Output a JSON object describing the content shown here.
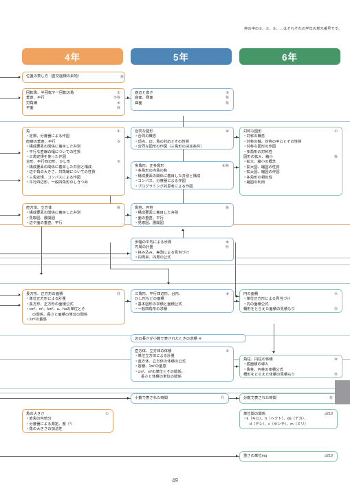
{
  "page": {
    "note": "枠の中の①、②、③、…はそれぞれの学年の単元番号です。",
    "page_number": "49",
    "colors": {
      "grade4": "#f0a35e",
      "grade5": "#4e86b8",
      "grade6": "#479668",
      "grade4_border": "#e2a765",
      "grade5_border": "#8fb4d4",
      "grade6_border": "#8dc1a5"
    }
  },
  "headers": {
    "grade4": "4年",
    "grade5": "5年",
    "grade6": "6年"
  },
  "boxes": {
    "g4_position": {
      "lines": [
        {
          "text": "位置の表し方（直交座標の素地）",
          "num": "⑲"
        }
      ]
    },
    "g4_rotation": {
      "lines": [
        {
          "text": "回転角、半回転や一回転の角",
          "num": "①"
        },
        {
          "text": "垂直、平行",
          "num": "⑤⑱"
        },
        {
          "text": "対角線",
          "num": "⑤"
        },
        {
          "text": "平面",
          "num": "⑱"
        }
      ]
    },
    "g5_base": {
      "lines": [
        {
          "text": "底辺と高さ",
          "num": "⑨"
        },
        {
          "text": "底面、側面",
          "num": "⑯"
        },
        {
          "text": "曲面",
          "num": "⑯"
        }
      ]
    },
    "g4_angle_shapes": {
      "lines": [
        {
          "text": "角",
          "num": "①",
          "kind": "head"
        },
        {
          "text": "定規、分度器による作図",
          "kind": "sub"
        },
        {
          "text": "直線の垂直、平行",
          "num": "⑤",
          "kind": "head"
        },
        {
          "text": "構成要素の関係に着目した弁別",
          "kind": "sub"
        },
        {
          "text": "平行な直線の幅についての性質",
          "kind": "sub"
        },
        {
          "text": "三角定規を使った作図",
          "kind": "sub"
        },
        {
          "text": "台形、平行四辺形、ひし形",
          "num": "⑤",
          "kind": "head"
        },
        {
          "text": "構成要素の関係に着目した弁別と構成",
          "kind": "sub"
        },
        {
          "text": "辺や角の大きさ、対角線についての性質",
          "kind": "sub"
        },
        {
          "text": "三角定規、コンパスによる作図",
          "kind": "sub"
        },
        {
          "text": "平行四辺形、一般四角形のしきつめ",
          "kind": "sub"
        }
      ]
    },
    "g5_congruent": {
      "lines": [
        {
          "text": "合同な図形",
          "num": "⑥",
          "kind": "head"
        },
        {
          "text": "合同の概念",
          "kind": "sub"
        },
        {
          "text": "頂点、辺、角の対応とその性質",
          "kind": "sub"
        },
        {
          "text": "合同な図形の作図（三角形の決定条件）",
          "kind": "sub"
        }
      ]
    },
    "g5_polygon": {
      "lines": [
        {
          "text": "多角形、正多角形",
          "num": "⑥⑱",
          "kind": "head"
        },
        {
          "text": "多角形の内角の和",
          "kind": "sub"
        },
        {
          "text": "構成要素の関係に着目した弁別と構成",
          "kind": "sub"
        },
        {
          "text": "コンパス、分度器による作図",
          "kind": "sub"
        },
        {
          "text": "プログラミング的思考による作図",
          "kind": "sub"
        }
      ]
    },
    "g6_symmetry": {
      "lines": [
        {
          "text": "対称な図形",
          "num": "①",
          "kind": "head"
        },
        {
          "text": "対称の概念",
          "kind": "sub"
        },
        {
          "text": "対称の軸、対称の中心とその性質",
          "kind": "sub"
        },
        {
          "text": "対称な図形の作図",
          "kind": "sub"
        },
        {
          "text": "多角形の対称性",
          "kind": "sub"
        },
        {
          "text": "図形の拡大、縮小",
          "num": "⑱",
          "kind": "head"
        },
        {
          "text": "拡大、縮小の概念",
          "kind": "sub"
        },
        {
          "text": "拡大図、縮図の性質",
          "kind": "sub"
        },
        {
          "text": "拡大図、縮図の作図",
          "kind": "sub"
        },
        {
          "text": "多角形の相似性",
          "kind": "sub"
        },
        {
          "text": "縮図の利用",
          "kind": "sub"
        }
      ]
    },
    "g4_solid": {
      "lines": [
        {
          "text": "直方体、立方体",
          "num": "⑱",
          "kind": "head"
        },
        {
          "text": "構成要素の関係に着目した弁別",
          "kind": "sub"
        },
        {
          "text": "見取図、展開図",
          "kind": "sub"
        },
        {
          "text": "辺や面の垂直、平行",
          "kind": "sub"
        }
      ]
    },
    "g5_prism": {
      "lines": [
        {
          "text": "角柱、円柱",
          "num": "⑯",
          "kind": "head"
        },
        {
          "text": "構成要素に着目した弁別",
          "kind": "sub"
        },
        {
          "text": "面の垂直、平行",
          "kind": "sub"
        },
        {
          "text": "見取図、展開図",
          "kind": "sub"
        }
      ]
    },
    "g5_circumference": {
      "lines": [
        {
          "text": "歩幅の平均による歩測",
          "num": "⑩",
          "kind": "head"
        },
        {
          "text": "円周の計量",
          "num": "⑭",
          "kind": "head"
        },
        {
          "text": "挟み込み、実測による見当づけ",
          "kind": "sub"
        },
        {
          "text": "円周率、円周の公式",
          "kind": "sub"
        }
      ]
    },
    "g4_area": {
      "lines": [
        {
          "text": "長方形、正方形の面積",
          "num": "⑬",
          "kind": "head"
        },
        {
          "text": "単位正方形による計量",
          "kind": "sub"
        },
        {
          "text": "長方形、正方形の面積公式",
          "kind": "sub"
        },
        {
          "text": "cm²、m²、km²、a、haの単位とそ",
          "kind": "sub"
        },
        {
          "text": "の関係、長さと面積の単位の関係",
          "kind": "ind"
        },
        {
          "text": "1m²の量感",
          "kind": "sub"
        }
      ]
    },
    "g5_area": {
      "lines": [
        {
          "text": "三角形、平行四辺形、台形、",
          "num": "⑨",
          "kind": "head"
        },
        {
          "text": "ひし形などの面積",
          "kind": "head"
        },
        {
          "text": "基本図形の求積と面積公式",
          "kind": "sub"
        },
        {
          "text": "一般四角形の求積",
          "kind": "sub"
        }
      ]
    },
    "g6_circle_area": {
      "lines": [
        {
          "text": "円の面積",
          "num": "⑦",
          "kind": "head"
        },
        {
          "text": "単位正方形による見当づけ",
          "kind": "sub"
        },
        {
          "text": "円の面積公式",
          "kind": "sub"
        },
        {
          "text": "概形をとらえた面積の見積もり",
          "num": "⑪",
          "kind": "head"
        }
      ]
    },
    "g5_decimal_area": {
      "lines": [
        {
          "text": "辺の長さが小数で表されたときの求積 ④"
        }
      ]
    },
    "g5_volume": {
      "lines": [
        {
          "text": "直方体、立方体の体積",
          "num": "②",
          "kind": "head"
        },
        {
          "text": "単位立方体による計量",
          "kind": "sub"
        },
        {
          "text": "直方体、立方体の体積の公式",
          "kind": "sub"
        },
        {
          "text": "容積、1m³の量感",
          "kind": "sub"
        },
        {
          "text": "cm³、m³の単位とその関係、",
          "kind": "sub"
        },
        {
          "text": "長さと体積の単位の関係",
          "kind": "ind"
        }
      ]
    },
    "g6_volume": {
      "lines": [
        {
          "text": "角柱、円柱の体積",
          "num": "⑧",
          "kind": "head"
        },
        {
          "text": "底面積の導入",
          "kind": "sub"
        },
        {
          "text": "角柱、円柱の体積公式",
          "kind": "sub"
        },
        {
          "text": "概形をとらえた体積の見積もり",
          "num": "⑪",
          "kind": "head"
        }
      ]
    },
    "g5_decimal_time": {
      "lines": [
        {
          "text": "小数で表された時間",
          "num": "⑪"
        }
      ]
    },
    "g6_fraction_time": {
      "lines": [
        {
          "text": "分数で表された時間",
          "num": "⑬"
        }
      ]
    },
    "g4_angle_size": {
      "lines": [
        {
          "text": "角の大きさ",
          "num": "①",
          "kind": "head"
        },
        {
          "text": "直角の何倍分",
          "kind": "sub"
        },
        {
          "text": "分度器による測定、度（°）",
          "kind": "sub"
        },
        {
          "text": "角の大きさの加法性",
          "kind": "sub"
        }
      ]
    },
    "g6_unit_relation": {
      "lines": [
        {
          "text": "単位間の関係",
          "num": "p219",
          "kind": "head"
        },
        {
          "text": "k（キロ）、h（ヘクト）、da（デカ）、",
          "kind": "sub"
        },
        {
          "text": "d（デシ）、c（センチ）、m（ミリ）",
          "kind": "ind"
        }
      ]
    },
    "g6_mass_unit": {
      "lines": [
        {
          "text": "重さの単位mg",
          "num": "p219"
        }
      ]
    }
  }
}
